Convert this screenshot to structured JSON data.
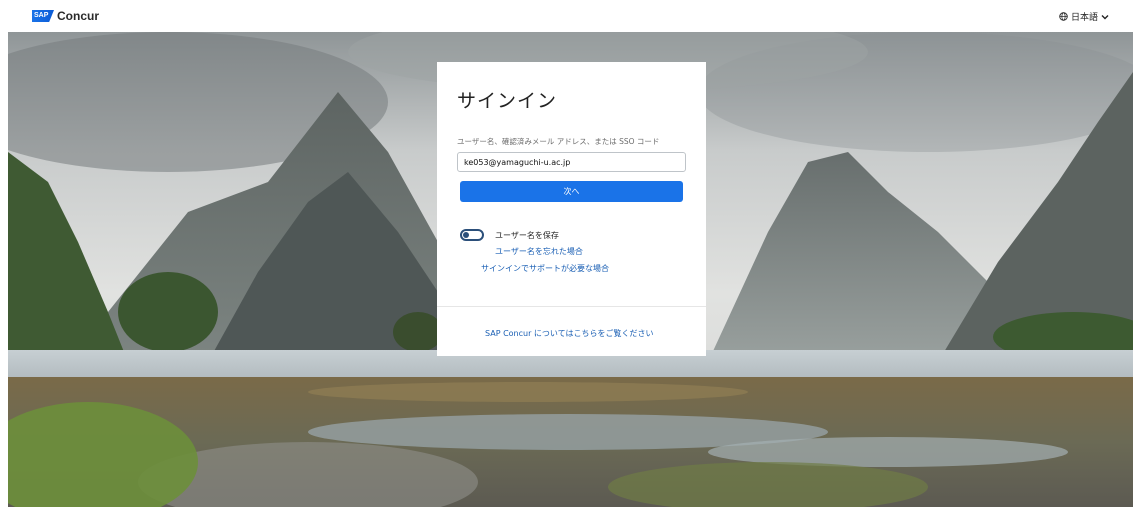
{
  "header": {
    "logo_mark": "SAP",
    "logo_text": "Concur",
    "language_label": "日本語",
    "icons": {
      "globe": "globe-icon",
      "chevron": "chevron-down-icon"
    }
  },
  "signin": {
    "title": "サインイン",
    "field_label": "ユーザー名、確認済みメール アドレス、または SSO コード",
    "field_value": "ke053@yamaguchi-u.ac.jp",
    "next_button": "次へ",
    "remember_label": "ユーザー名を保存",
    "remember_enabled": false,
    "forgot_link": "ユーザー名を忘れた場合",
    "help_link": "サインインでサポートが必要な場合",
    "about_link": "SAP Concur についてはこちらをご覧ください"
  },
  "colors": {
    "accent": "#1a73e8",
    "link": "#1a5fb4",
    "toggle": "#2b4f7a"
  }
}
